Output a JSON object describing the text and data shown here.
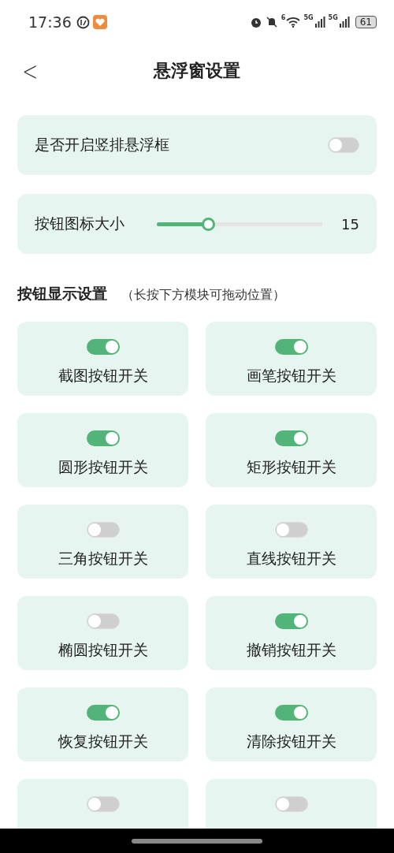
{
  "status_bar": {
    "time": "17:36",
    "signal_labels": [
      "5G",
      "5G"
    ],
    "wifi_label": "6",
    "battery": "61"
  },
  "header": {
    "back": "<",
    "title": "悬浮窗设置"
  },
  "vertical_toggle": {
    "label": "是否开启竖排悬浮框",
    "on": false
  },
  "icon_size": {
    "label": "按钮图标大小",
    "level": 0.31,
    "reading": "15"
  },
  "section": {
    "title": "按钮显示设置",
    "hint": "（长按下方模块可拖动位置）"
  },
  "buttons": [
    {
      "label": "截图按钮开关",
      "on": true
    },
    {
      "label": "画笔按钮开关",
      "on": true
    },
    {
      "label": "圆形按钮开关",
      "on": true
    },
    {
      "label": "矩形按钮开关",
      "on": true
    },
    {
      "label": "三角按钮开关",
      "on": false
    },
    {
      "label": "直线按钮开关",
      "on": false
    },
    {
      "label": "椭圆按钮开关",
      "on": false
    },
    {
      "label": "撤销按钮开关",
      "on": true
    },
    {
      "label": "恢复按钮开关",
      "on": true
    },
    {
      "label": "清除按钮开关",
      "on": true
    },
    {
      "on": false
    },
    {
      "on": false
    }
  ]
}
